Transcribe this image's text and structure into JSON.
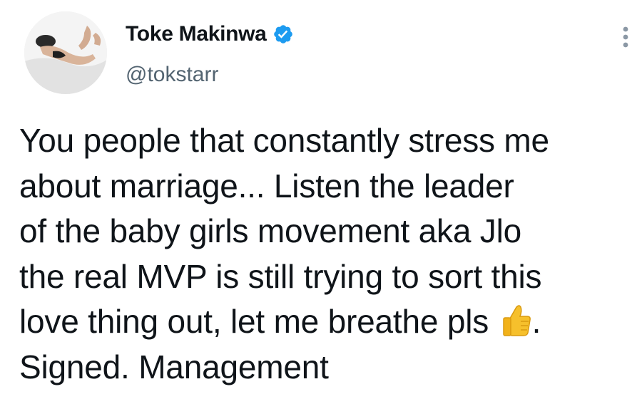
{
  "author": {
    "display_name": "Toke Makinwa",
    "handle": "@tokstarr",
    "verified": true,
    "avatar": "profile-photo",
    "verified_badge_color": "#1d9bf0"
  },
  "menu": {
    "icon": "more-vertical-icon"
  },
  "tweet": {
    "lines": [
      "You people that constantly stress me",
      "about marriage... Listen the leader",
      "of the baby girls movement aka Jlo",
      "the real MVP is still trying to sort this",
      "love thing out, let me breathe pls",
      "Signed. Management"
    ],
    "line5_trailing": ".",
    "emoji": "thumbs-up-icon"
  },
  "colors": {
    "text": "#0f1419",
    "secondary": "#536471",
    "accent": "#1d9bf0"
  }
}
